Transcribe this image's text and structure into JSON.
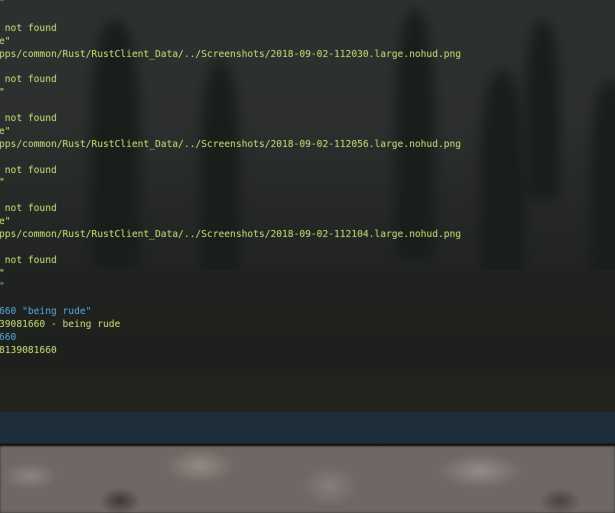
{
  "console": {
    "log_lines": [
      {
        "text": "\"",
        "color": "green"
      },
      {
        "text": "",
        "color": "green"
      },
      {
        "text": " not found",
        "color": "green"
      },
      {
        "text": "e\"",
        "color": "green"
      },
      {
        "text": "pps/common/Rust/RustClient_Data/../Screenshots/2018-09-02-112030.large.nohud.png",
        "color": "green"
      },
      {
        "text": "",
        "color": "green"
      },
      {
        "text": " not found",
        "color": "green"
      },
      {
        "text": "\"",
        "color": "green"
      },
      {
        "text": "",
        "color": "green"
      },
      {
        "text": " not found",
        "color": "green"
      },
      {
        "text": "e\"",
        "color": "green"
      },
      {
        "text": "pps/common/Rust/RustClient_Data/../Screenshots/2018-09-02-112056.large.nohud.png",
        "color": "green"
      },
      {
        "text": "",
        "color": "green"
      },
      {
        "text": " not found",
        "color": "green"
      },
      {
        "text": "\"",
        "color": "green"
      },
      {
        "text": "",
        "color": "green"
      },
      {
        "text": " not found",
        "color": "green"
      },
      {
        "text": "e\"",
        "color": "green"
      },
      {
        "text": "pps/common/Rust/RustClient_Data/../Screenshots/2018-09-02-112104.large.nohud.png",
        "color": "green"
      },
      {
        "text": "",
        "color": "green"
      },
      {
        "text": " not found",
        "color": "green"
      },
      {
        "text": "\"",
        "color": "green"
      },
      {
        "text": "\"",
        "color": "blue"
      },
      {
        "text": "",
        "color": "green"
      },
      {
        "text": "660 \"being rude\"",
        "color": "blue"
      },
      {
        "text": "39081660 - being rude",
        "color": "green"
      },
      {
        "text": "660",
        "color": "blue"
      },
      {
        "text": "8139081660",
        "color": "green"
      }
    ],
    "input": {
      "value": "",
      "placeholder": ""
    }
  },
  "colors": {
    "log_green": "#b9cc6e",
    "log_blue": "#4f9bc7",
    "input_bar": "#1f2e3b"
  }
}
